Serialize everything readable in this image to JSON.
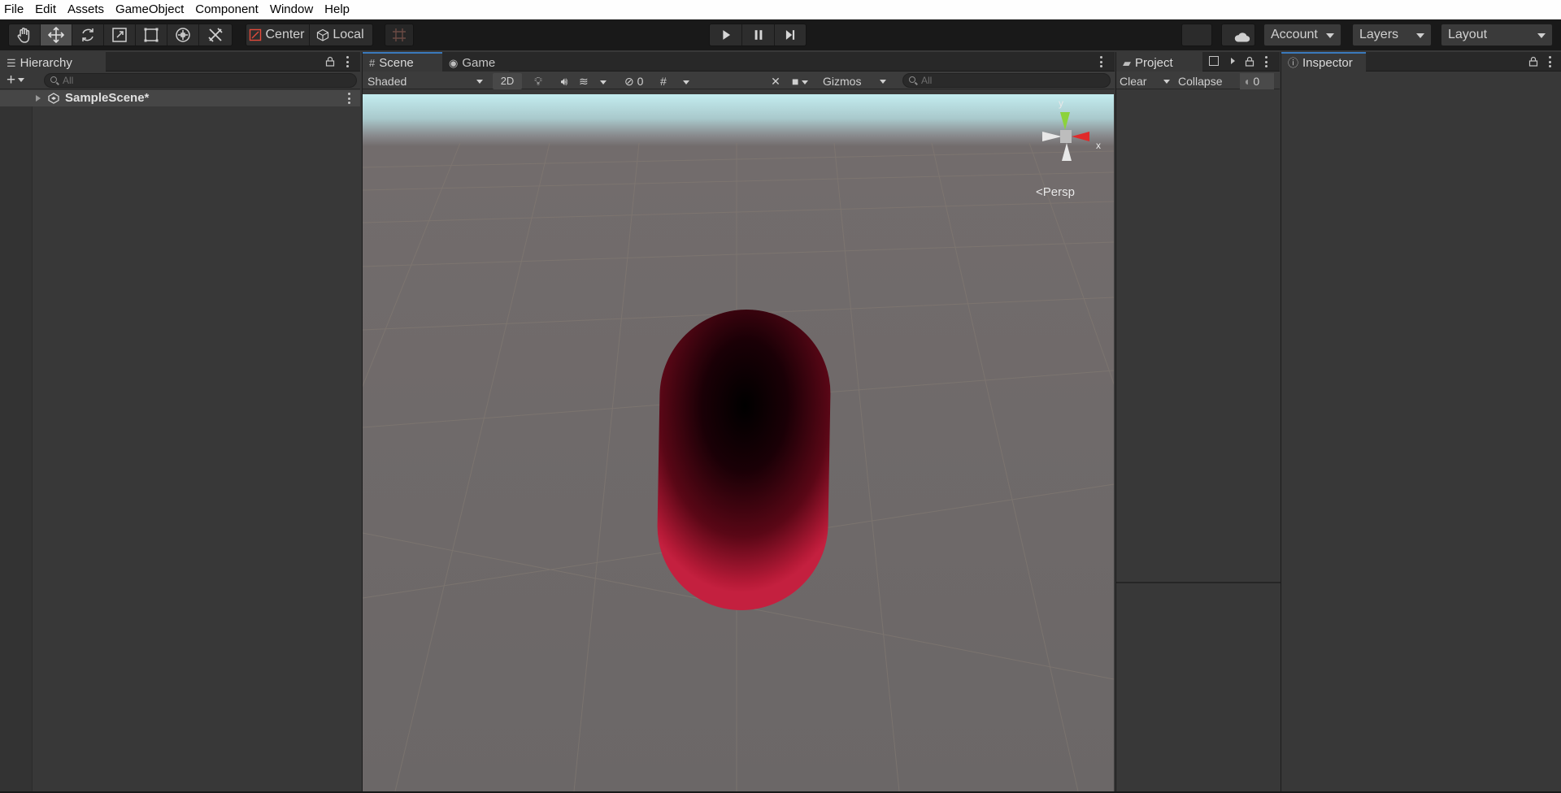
{
  "menu": [
    "File",
    "Edit",
    "Assets",
    "GameObject",
    "Component",
    "Window",
    "Help"
  ],
  "toolbar": {
    "pivot_label": "Center",
    "space_label": "Local",
    "account_label": "Account",
    "layers_label": "Layers",
    "layout_label": "Layout"
  },
  "hierarchy": {
    "tab_label": "Hierarchy",
    "search_placeholder": "All",
    "scene_name": "SampleScene*"
  },
  "scene": {
    "tab_scene": "Scene",
    "tab_game": "Game",
    "shading_mode": "Shaded",
    "mode_2d": "2D",
    "hidden_count": "0",
    "gizmos_label": "Gizmos",
    "search_placeholder": "All",
    "axis_y": "y",
    "axis_x": "x",
    "projection_label": "Persp"
  },
  "project": {
    "tab_label": "Project",
    "clear_label": "Clear",
    "collapse_label": "Collapse",
    "message_count": "0"
  },
  "inspector": {
    "tab_label": "Inspector"
  },
  "colors": {
    "tab_accent": "#3a79bb",
    "capsule_rim": "#c4203f",
    "gizmo_y": "#8cd23c",
    "gizmo_x": "#e02a2a"
  }
}
